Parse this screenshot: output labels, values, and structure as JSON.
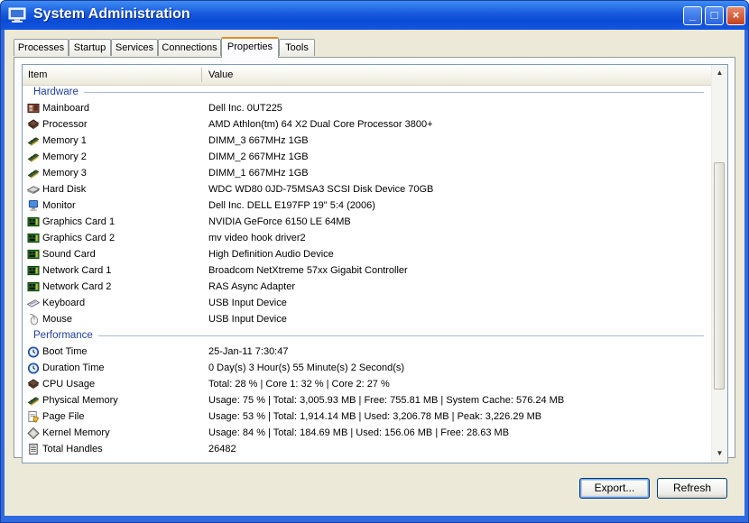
{
  "window": {
    "title": "System Administration"
  },
  "titlebar_buttons": {
    "minimize": "_",
    "maximize": "□",
    "close": "×"
  },
  "tabs": [
    {
      "label": "Processes",
      "active": false
    },
    {
      "label": "Startup",
      "active": false
    },
    {
      "label": "Services",
      "active": false
    },
    {
      "label": "Connections",
      "active": false
    },
    {
      "label": "Properties",
      "active": true
    },
    {
      "label": "Tools",
      "active": false
    }
  ],
  "list": {
    "columns": {
      "item": "Item",
      "value": "Value"
    },
    "groups": [
      {
        "label": "Hardware",
        "rows": [
          {
            "icon": "mainboard-icon",
            "item": "Mainboard",
            "value": "Dell Inc. 0UT225"
          },
          {
            "icon": "processor-icon",
            "item": "Processor",
            "value": "AMD Athlon(tm) 64 X2 Dual Core Processor 3800+"
          },
          {
            "icon": "memory-icon",
            "item": "Memory 1",
            "value": "DIMM_3 667MHz 1GB"
          },
          {
            "icon": "memory-icon",
            "item": "Memory 2",
            "value": "DIMM_2 667MHz 1GB"
          },
          {
            "icon": "memory-icon",
            "item": "Memory 3",
            "value": "DIMM_1 667MHz 1GB"
          },
          {
            "icon": "hard-disk-icon",
            "item": "Hard Disk",
            "value": "WDC WD80 0JD-75MSA3 SCSI Disk Device 70GB"
          },
          {
            "icon": "monitor-icon",
            "item": "Monitor",
            "value": "Dell Inc. DELL E197FP 19\" 5:4 (2006)"
          },
          {
            "icon": "card-icon",
            "item": "Graphics Card 1",
            "value": "NVIDIA GeForce 6150 LE 64MB"
          },
          {
            "icon": "card-icon",
            "item": "Graphics Card 2",
            "value": "mv video hook driver2"
          },
          {
            "icon": "card-icon",
            "item": "Sound Card",
            "value": "High Definition Audio Device"
          },
          {
            "icon": "card-icon",
            "item": "Network Card 1",
            "value": "Broadcom NetXtreme 57xx Gigabit Controller"
          },
          {
            "icon": "card-icon",
            "item": "Network Card 2",
            "value": "RAS Async Adapter"
          },
          {
            "icon": "keyboard-icon",
            "item": "Keyboard",
            "value": "USB Input Device"
          },
          {
            "icon": "mouse-icon",
            "item": "Mouse",
            "value": "USB Input Device"
          }
        ]
      },
      {
        "label": "Performance",
        "rows": [
          {
            "icon": "clock-icon",
            "item": "Boot Time",
            "value": "25-Jan-11 7:30:47"
          },
          {
            "icon": "clock-icon",
            "item": "Duration Time",
            "value": "0 Day(s) 3 Hour(s) 55 Minute(s) 2 Second(s)"
          },
          {
            "icon": "processor-icon",
            "item": "CPU Usage",
            "value": "Total: 28 % | Core 1: 32 % | Core 2: 27 %"
          },
          {
            "icon": "memory-icon",
            "item": "Physical Memory",
            "value": "Usage: 75 % | Total: 3,005.93 MB | Free: 755.81 MB | System Cache: 576.24 MB"
          },
          {
            "icon": "page-file-icon",
            "item": "Page File",
            "value": "Usage: 53 % | Total: 1,914.14 MB | Used: 3,206.78 MB | Peak: 3,226.29 MB"
          },
          {
            "icon": "kernel-icon",
            "item": "Kernel Memory",
            "value": "Usage: 84 % | Total: 184.69 MB | Used: 156.06 MB | Free: 28.63 MB"
          },
          {
            "icon": "document-icon",
            "item": "Total Handles",
            "value": "26482"
          }
        ]
      }
    ]
  },
  "buttons": {
    "export": "Export...",
    "refresh": "Refresh"
  }
}
